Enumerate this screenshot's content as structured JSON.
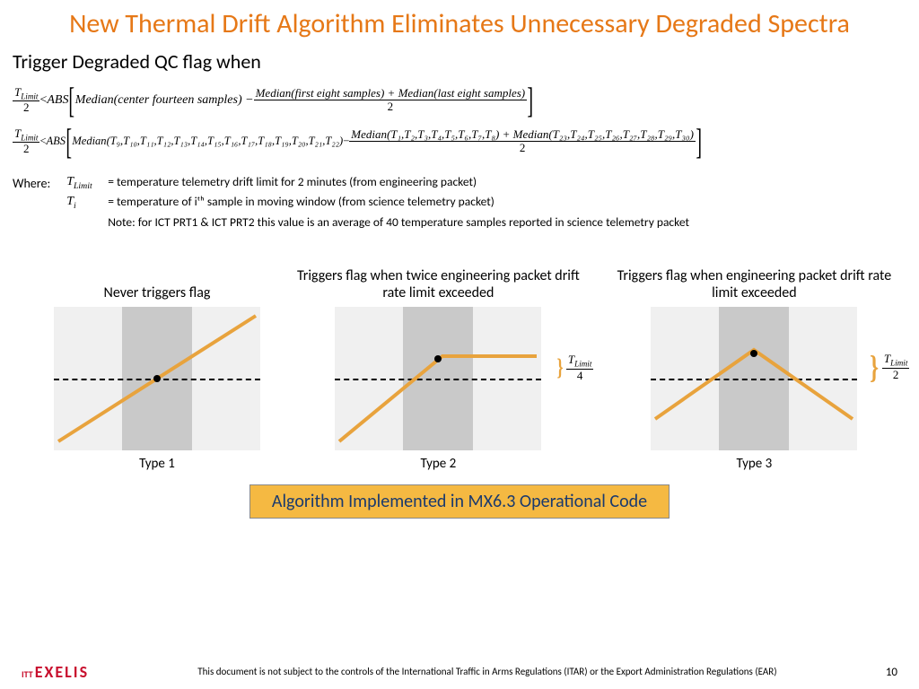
{
  "title": "New Thermal Drift Algorithm Eliminates Unnecessary Degraded Spectra",
  "subtitle": "Trigger Degraded QC flag when",
  "formula": {
    "lhs_top": "T",
    "lhs_sub": "Limit",
    "lhs_bot": "2",
    "lt": " < ",
    "abs": "ABS",
    "line1_inner": "Median(center fourteen samples) − ",
    "line1_frac_top": "Median(first eight samples) + Median(last eight samples)",
    "line1_frac_bot": "2",
    "line2_median": "Median",
    "line2_center_args": "(T₉,T₁₀,T₁₁,T₁₂,T₁₃,T₁₄,T₁₅,T₁₆,T₁₇,T₁₈,T₁₉,T₂₀,T₂₁,T₂₂)",
    "line2_frac_top": "Median(T₁,T₂,T₃,T₄,T₅,T₆,T₇,T₈) + Median(T₂₃,T₂₄,T₂₅,T₂₆,T₂₇,T₂₈,T₂₉,T₃₀)",
    "line2_frac_bot": "2"
  },
  "where": {
    "label": "Where:",
    "rows": [
      {
        "sym": "T_Limit",
        "txt": "= temperature telemetry drift limit for 2 minutes  (from engineering packet)"
      },
      {
        "sym": "T_i",
        "txt": "= temperature of iᵗʰ sample in moving window (from science telemetry packet)"
      }
    ],
    "note": "Note: for ICT PRT1 & ICT PRT2 this value is an average of 40 temperature samples reported in science telemetry packet"
  },
  "charts": [
    {
      "title": "Never triggers flag",
      "label": "Type 1"
    },
    {
      "title": "Triggers flag when twice engineering packet drift rate limit exceeded",
      "label": "Type 2",
      "annot_top": "T_Limit",
      "annot_bot": "4"
    },
    {
      "title": "Triggers flag when engineering packet drift rate limit exceeded",
      "label": "Type 3",
      "annot_top": "T_Limit",
      "annot_bot": "2"
    }
  ],
  "banner": "Algorithm Implemented in MX6.3 Operational Code",
  "footer": {
    "logo_small": "ITT",
    "logo_main": "EXELIS",
    "disclaimer": "This document is not subject to the controls of the International Traffic in Arms Regulations (ITAR) or the Export Administration Regulations (EAR)",
    "page": "10"
  },
  "chart_data": [
    {
      "type": "line",
      "title": "Type 1 — Never triggers flag",
      "description": "Linear monotonic drift through center; deviation of middle from outer-segment mean is zero",
      "dashed_ref": 0,
      "segments": [
        {
          "x": [
            0,
            1
          ],
          "y": [
            -1,
            1
          ]
        }
      ],
      "dot": {
        "x": 0.5,
        "y": 0.0
      }
    },
    {
      "type": "line",
      "title": "Type 2 — Triggers at 2× drift-rate limit",
      "description": "Ramp then plateau; middle median exceeds outer mean by T_Limit/4",
      "dashed_ref": 0,
      "segments": [
        {
          "x": [
            0,
            0.55,
            1
          ],
          "y": [
            -0.9,
            0.35,
            0.35
          ]
        }
      ],
      "dot": {
        "x": 0.5,
        "y": 0.3
      },
      "annotation": "T_Limit / 4"
    },
    {
      "type": "line",
      "title": "Type 3 — Triggers at engineering drift-rate limit",
      "description": "Peak at center; middle median exceeds outer mean by T_Limit/2",
      "dashed_ref": 0,
      "segments": [
        {
          "x": [
            0,
            0.5,
            1
          ],
          "y": [
            -0.55,
            0.4,
            -0.55
          ]
        }
      ],
      "dot": {
        "x": 0.5,
        "y": 0.35
      },
      "annotation": "T_Limit / 2"
    }
  ]
}
